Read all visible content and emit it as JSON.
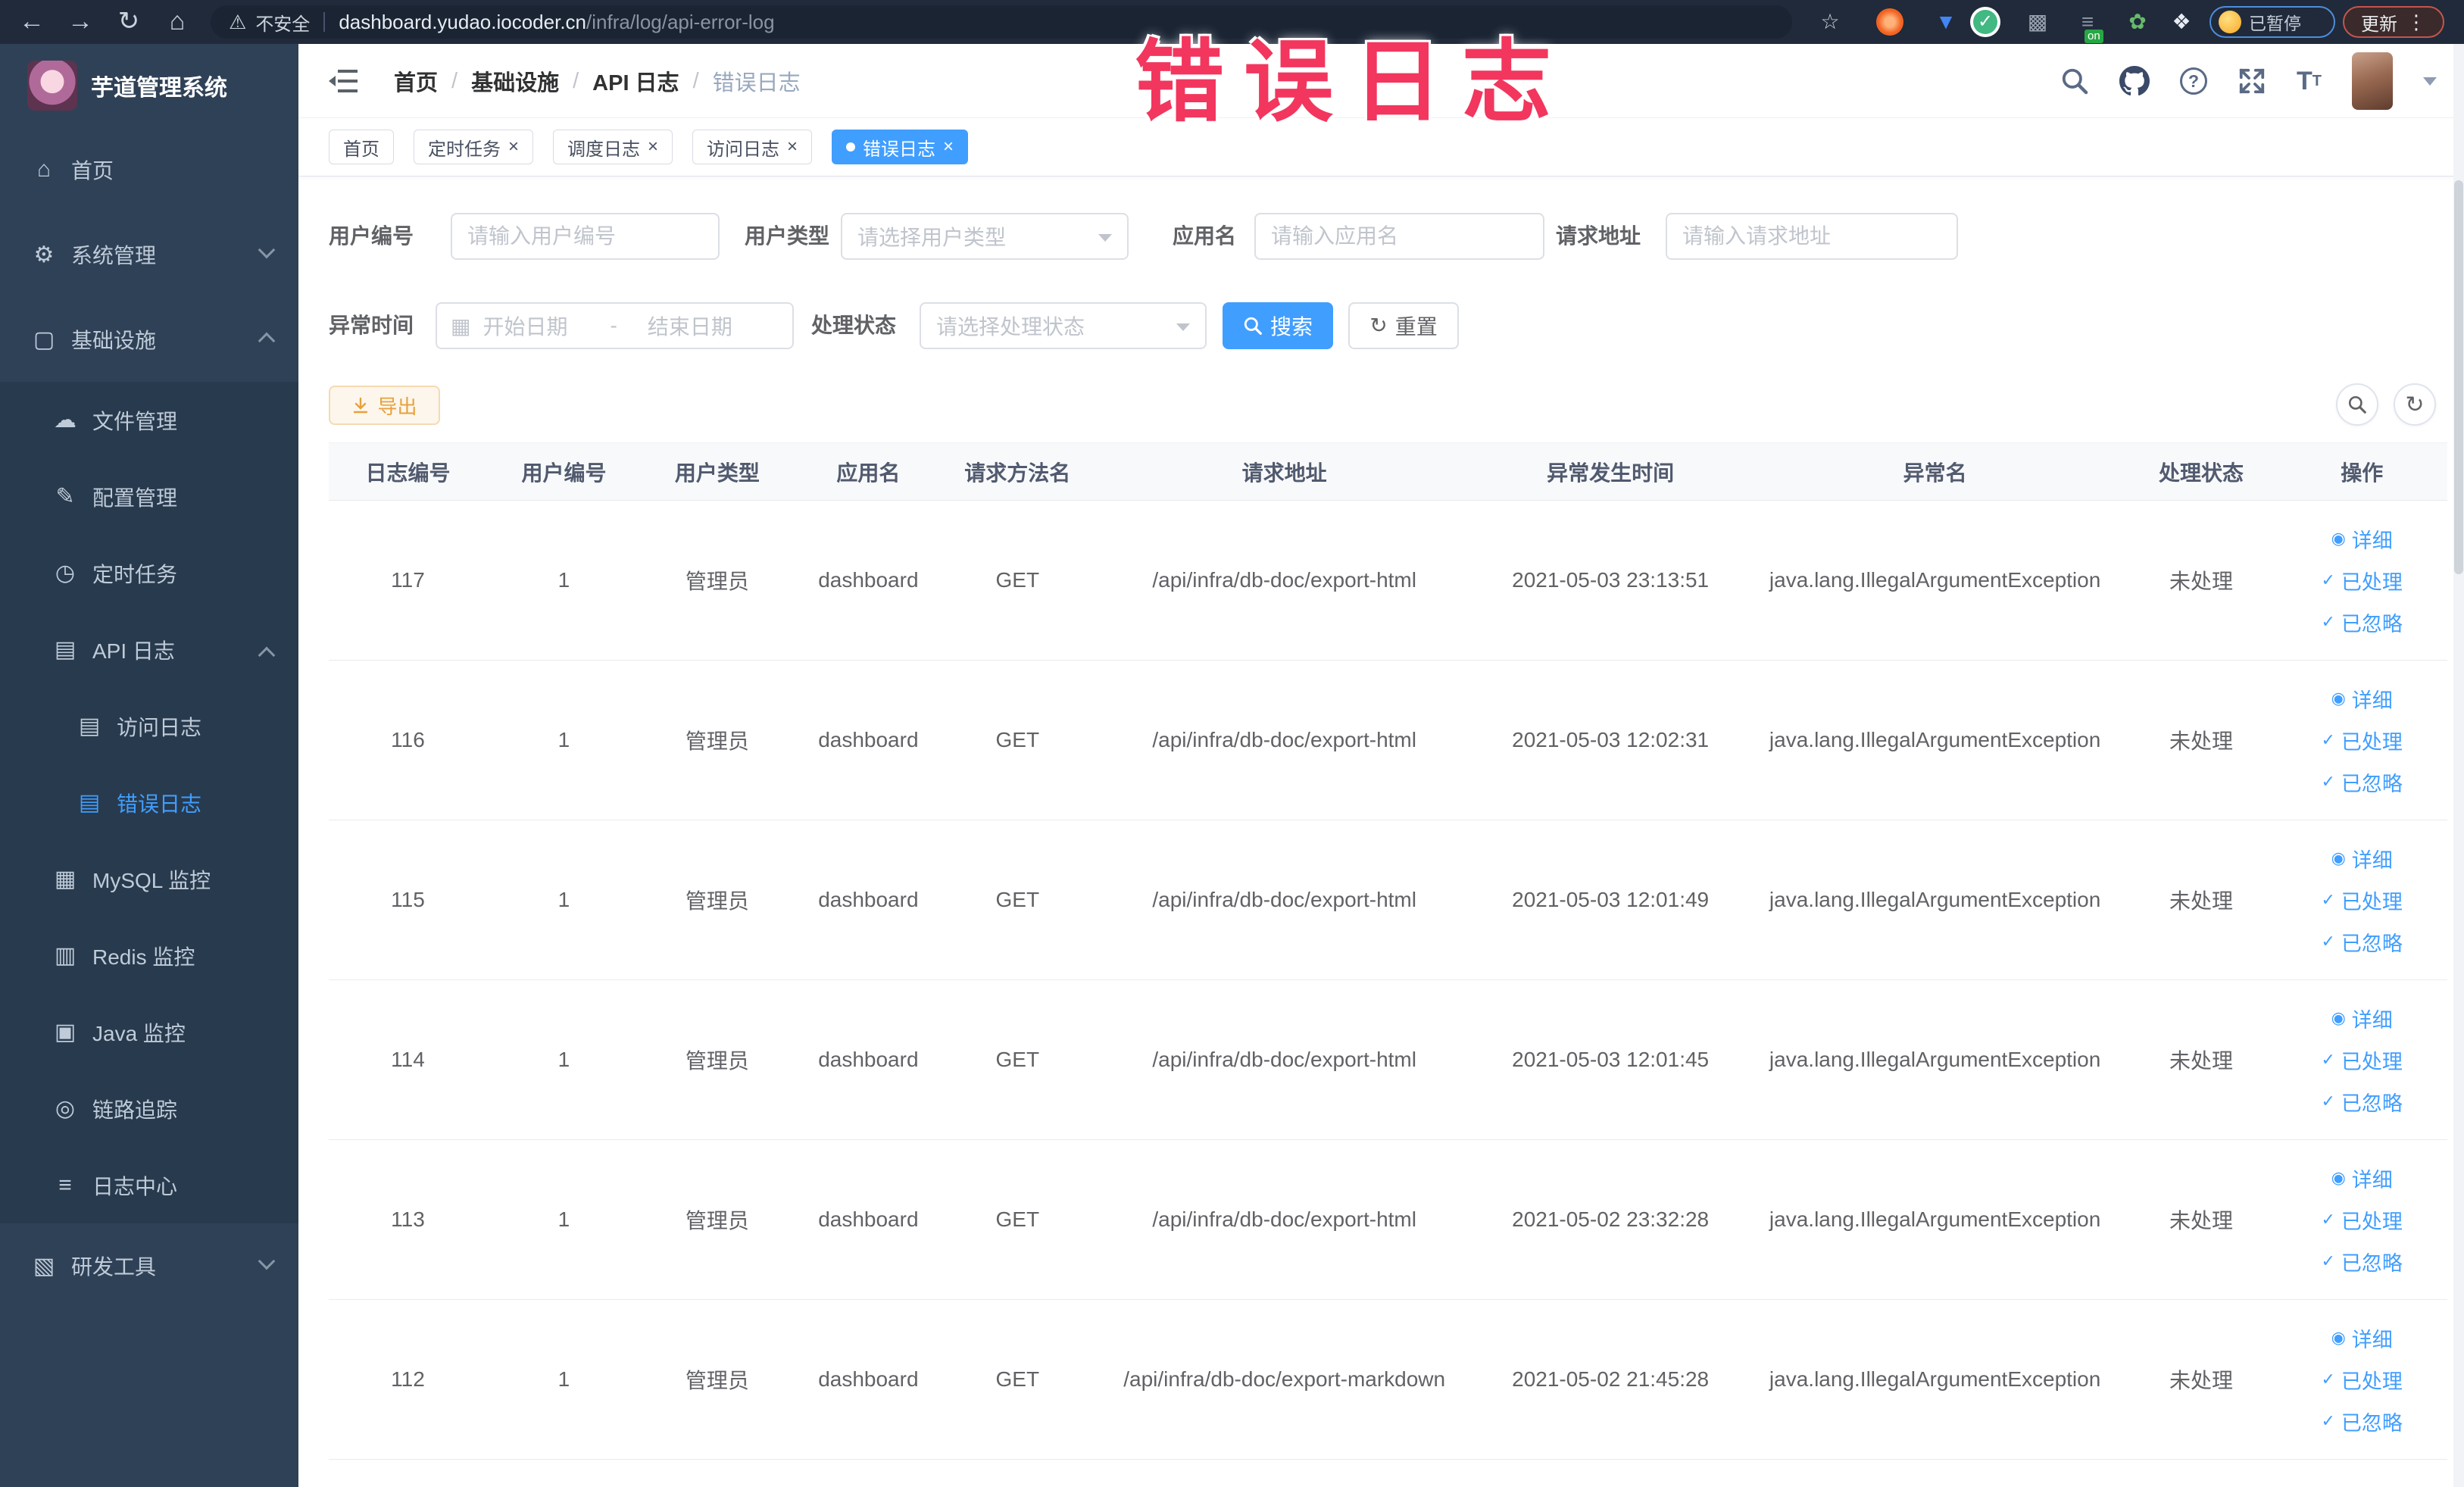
{
  "browser": {
    "security_label": "不安全",
    "url_host": "dashboard.yudao.iocoder.cn",
    "url_path": "/infra/log/api-error-log",
    "ext_on_badge": "on",
    "paused_badge_label": "已暂停",
    "update_button_label": "更新"
  },
  "annotation": {
    "text": "错误日志",
    "color": "#f2365e"
  },
  "colors": {
    "primary": "#409eff",
    "sidebar_bg": "#2f4156",
    "sidebar_sub_bg": "#283a4d"
  },
  "sidebar": {
    "title": "芋道管理系统",
    "items": [
      {
        "key": "home",
        "label": "首页",
        "icon": "home",
        "level": 0
      },
      {
        "key": "system-mgmt",
        "label": "系统管理",
        "icon": "gear",
        "level": 0,
        "chevron": "down"
      },
      {
        "key": "infrastructure",
        "label": "基础设施",
        "icon": "monitor",
        "level": 0,
        "chevron": "up"
      },
      {
        "key": "file-mgmt",
        "label": "文件管理",
        "icon": "cloud",
        "level": 1,
        "sub": true
      },
      {
        "key": "config-mgmt",
        "label": "配置管理",
        "icon": "edit",
        "level": 1,
        "sub": true
      },
      {
        "key": "scheduled-jobs",
        "label": "定时任务",
        "icon": "timer",
        "level": 1,
        "sub": true
      },
      {
        "key": "api-log",
        "label": "API 日志",
        "icon": "log",
        "level": 1,
        "sub": true,
        "chevron": "up"
      },
      {
        "key": "access-log",
        "label": "访问日志",
        "icon": "log",
        "level": 2,
        "sub": true
      },
      {
        "key": "error-log",
        "label": "错误日志",
        "icon": "log",
        "level": 2,
        "sub": true,
        "active": true
      },
      {
        "key": "mysql-monitor",
        "label": "MySQL 监控",
        "icon": "mysql",
        "level": 1,
        "sub": true
      },
      {
        "key": "redis-monitor",
        "label": "Redis 监控",
        "icon": "redis",
        "level": 1,
        "sub": true
      },
      {
        "key": "java-monitor",
        "label": "Java 监控",
        "icon": "java",
        "level": 1,
        "sub": true
      },
      {
        "key": "tracing",
        "label": "链路追踪",
        "icon": "trace",
        "level": 1,
        "sub": true
      },
      {
        "key": "log-center",
        "label": "日志中心",
        "icon": "logcenter",
        "level": 1,
        "sub": true
      },
      {
        "key": "dev-tools",
        "label": "研发工具",
        "icon": "briefcase",
        "level": 0,
        "chevron": "down"
      }
    ]
  },
  "header": {
    "breadcrumb": [
      "首页",
      "基础设施",
      "API 日志",
      "错误日志"
    ]
  },
  "tags": [
    {
      "key": "home",
      "label": "首页",
      "closable": false,
      "active": false
    },
    {
      "key": "scheduled-jobs",
      "label": "定时任务",
      "closable": true,
      "active": false
    },
    {
      "key": "schedule-log",
      "label": "调度日志",
      "closable": true,
      "active": false
    },
    {
      "key": "access-log",
      "label": "访问日志",
      "closable": true,
      "active": false
    },
    {
      "key": "error-log",
      "label": "错误日志",
      "closable": true,
      "active": true
    }
  ],
  "filters": {
    "user_id": {
      "label": "用户编号",
      "placeholder": "请输入用户编号"
    },
    "user_type": {
      "label": "用户类型",
      "placeholder": "请选择用户类型"
    },
    "app_name": {
      "label": "应用名",
      "placeholder": "请输入应用名"
    },
    "request_url": {
      "label": "请求地址",
      "placeholder": "请输入请求地址"
    },
    "exception_time": {
      "label": "异常时间",
      "start_placeholder": "开始日期",
      "separator": "-",
      "end_placeholder": "结束日期"
    },
    "process_status": {
      "label": "处理状态",
      "placeholder": "请选择处理状态"
    },
    "search_label": "搜索",
    "reset_label": "重置"
  },
  "toolbar": {
    "export_label": "导出"
  },
  "table": {
    "columns": [
      "日志编号",
      "用户编号",
      "用户类型",
      "应用名",
      "请求方法名",
      "请求地址",
      "异常发生时间",
      "异常名",
      "处理状态",
      "操作"
    ],
    "row_actions": [
      {
        "key": "detail",
        "label": "详细",
        "icon": "eye"
      },
      {
        "key": "processed",
        "label": "已处理",
        "icon": "check"
      },
      {
        "key": "ignored",
        "label": "已忽略",
        "icon": "check"
      }
    ],
    "rows": [
      {
        "id": "117",
        "user_id": "1",
        "user_type": "管理员",
        "app": "dashboard",
        "method": "GET",
        "url": "/api/infra/db-doc/export-html",
        "time": "2021-05-03 23:13:51",
        "exception": "java.lang.IllegalArgumentException",
        "status": "未处理"
      },
      {
        "id": "116",
        "user_id": "1",
        "user_type": "管理员",
        "app": "dashboard",
        "method": "GET",
        "url": "/api/infra/db-doc/export-html",
        "time": "2021-05-03 12:02:31",
        "exception": "java.lang.IllegalArgumentException",
        "status": "未处理"
      },
      {
        "id": "115",
        "user_id": "1",
        "user_type": "管理员",
        "app": "dashboard",
        "method": "GET",
        "url": "/api/infra/db-doc/export-html",
        "time": "2021-05-03 12:01:49",
        "exception": "java.lang.IllegalArgumentException",
        "status": "未处理"
      },
      {
        "id": "114",
        "user_id": "1",
        "user_type": "管理员",
        "app": "dashboard",
        "method": "GET",
        "url": "/api/infra/db-doc/export-html",
        "time": "2021-05-03 12:01:45",
        "exception": "java.lang.IllegalArgumentException",
        "status": "未处理"
      },
      {
        "id": "113",
        "user_id": "1",
        "user_type": "管理员",
        "app": "dashboard",
        "method": "GET",
        "url": "/api/infra/db-doc/export-html",
        "time": "2021-05-02 23:32:28",
        "exception": "java.lang.IllegalArgumentException",
        "status": "未处理"
      },
      {
        "id": "112",
        "user_id": "1",
        "user_type": "管理员",
        "app": "dashboard",
        "method": "GET",
        "url": "/api/infra/db-doc/export-markdown",
        "time": "2021-05-02 21:45:28",
        "exception": "java.lang.IllegalArgumentException",
        "status": "未处理"
      }
    ]
  }
}
